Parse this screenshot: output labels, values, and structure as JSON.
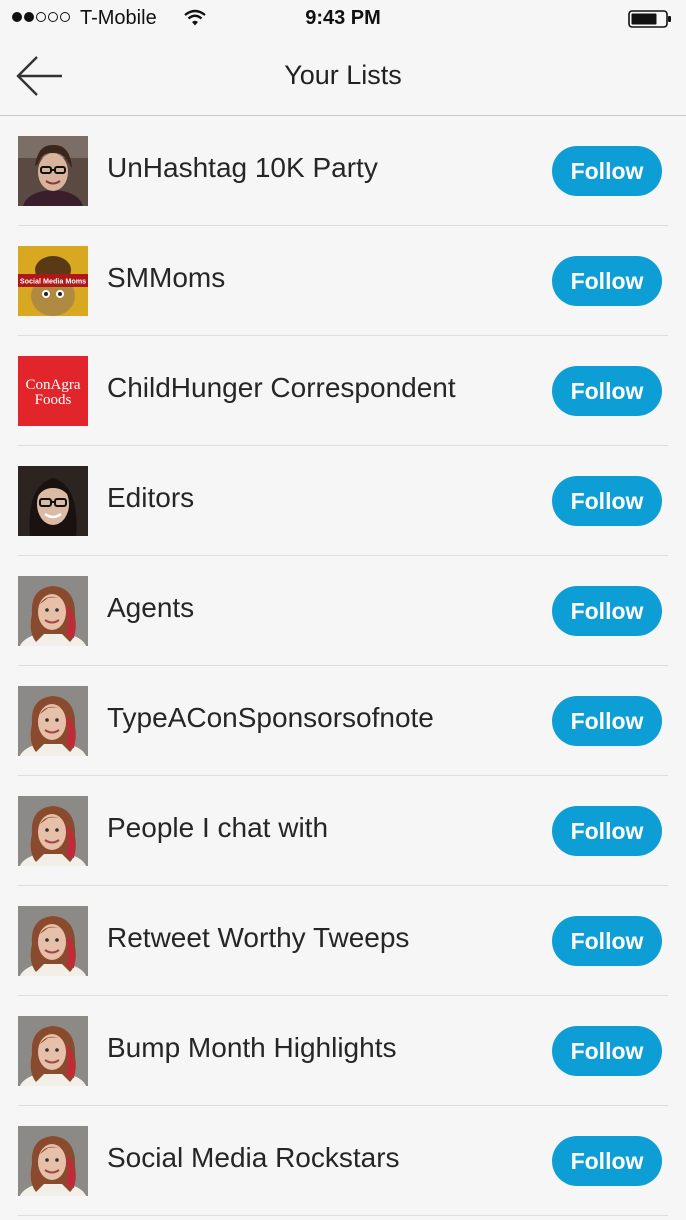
{
  "status_bar": {
    "carrier": "T-Mobile",
    "time": "9:43 PM"
  },
  "header": {
    "title": "Your Lists",
    "back_icon": "arrow-left-icon"
  },
  "lists": [
    {
      "label": "UnHashtag 10K Party",
      "button": "Follow",
      "avatar": "woman-glasses-photo"
    },
    {
      "label": "SMMoms",
      "button": "Follow",
      "avatar": "social-media-moms-logo"
    },
    {
      "label": "ChildHunger Correspondent",
      "button": "Follow",
      "avatar": "conagra-foods-logo"
    },
    {
      "label": "Editors",
      "button": "Follow",
      "avatar": "woman-glasses-photo"
    },
    {
      "label": "Agents",
      "button": "Follow",
      "avatar": "woman-red-hair-photo"
    },
    {
      "label": "TypeAConSponsorsofnote",
      "button": "Follow",
      "avatar": "woman-red-hair-photo"
    },
    {
      "label": "People I chat with",
      "button": "Follow",
      "avatar": "woman-red-hair-photo"
    },
    {
      "label": "Retweet Worthy Tweeps",
      "button": "Follow",
      "avatar": "woman-red-hair-photo"
    },
    {
      "label": "Bump Month Highlights",
      "button": "Follow",
      "avatar": "woman-red-hair-photo"
    },
    {
      "label": "Social Media Rockstars",
      "button": "Follow",
      "avatar": "woman-red-hair-photo"
    }
  ],
  "logos": {
    "conagra_line1": "ConAgra",
    "conagra_line2": "Foods",
    "smmoms_banner": "Social Media Moms"
  },
  "colors": {
    "accent": "#0e9ed6",
    "conagra_red": "#e2242b"
  }
}
